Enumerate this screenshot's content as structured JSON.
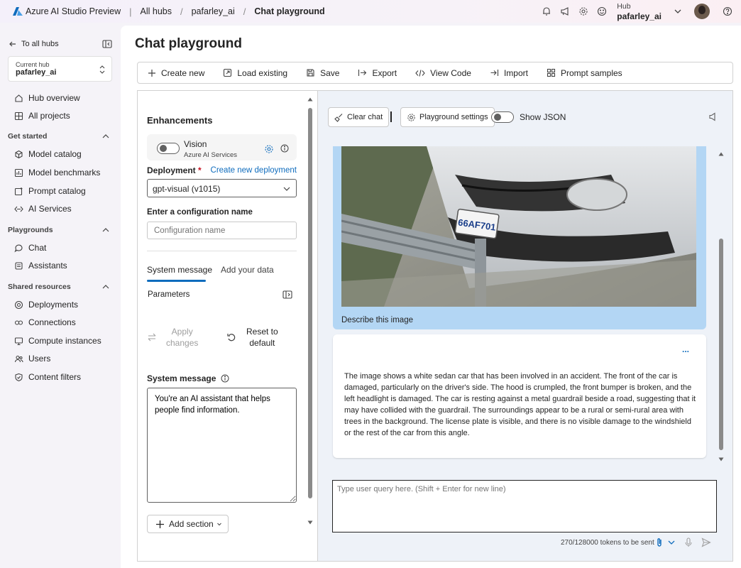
{
  "topbar": {
    "brand": "Azure AI Studio Preview",
    "breadcrumbs": [
      "All hubs",
      "pafarley_ai",
      "Chat playground"
    ],
    "hub_label": "Hub",
    "hub_name": "pafarley_ai"
  },
  "sidebar": {
    "back_label": "To all hubs",
    "current_hub_label": "Current hub",
    "current_hub_name": "pafarley_ai",
    "items_top": [
      "Hub overview",
      "All projects"
    ],
    "section_get_started": "Get started",
    "items_get_started": [
      "Model catalog",
      "Model benchmarks",
      "Prompt catalog",
      "AI Services"
    ],
    "section_playgrounds": "Playgrounds",
    "items_playgrounds": [
      "Chat",
      "Assistants"
    ],
    "section_shared": "Shared resources",
    "items_shared": [
      "Deployments",
      "Connections",
      "Compute instances",
      "Users",
      "Content filters"
    ]
  },
  "page": {
    "title": "Chat playground",
    "toolbar": [
      "Create new",
      "Load existing",
      "Save",
      "Export",
      "View Code",
      "Import",
      "Prompt samples"
    ]
  },
  "setup": {
    "enhancements_title": "Enhancements",
    "vision_label": "Vision",
    "vision_sub": "Azure AI Services",
    "deployment_label": "Deployment",
    "deployment_required": "*",
    "create_deployment_link": "Create new deployment",
    "deployment_value": "gpt-visual (v1015)",
    "config_label": "Enter a configuration name",
    "config_placeholder": "Configuration name",
    "tab_system": "System message",
    "tab_data": "Add your data",
    "parameters_label": "Parameters",
    "apply_line1": "Apply",
    "apply_line2": "changes",
    "reset_line1": "Reset to",
    "reset_line2": "default",
    "system_message_label": "System message",
    "system_message_value": "You're an AI assistant that helps people find information.",
    "add_section": "Add section"
  },
  "chat": {
    "clear_chat": "Clear chat",
    "playground_settings": "Playground settings",
    "show_json": "Show JSON",
    "user_caption": "Describe this image",
    "image_plate": "66AF701",
    "more": "...",
    "assistant_reply": "The image shows a white sedan car that has been involved in an accident. The front of the car is damaged, particularly on the driver's side. The hood is crumpled, the front bumper is broken, and the left headlight is damaged. The car is resting against a metal guardrail beside a road, suggesting that it may have collided with the guardrail. The surroundings appear to be a rural or semi-rural area with trees in the background. The license plate is visible, and there is no visible damage to the windshield or the rest of the car from this angle.",
    "input_placeholder": "Type user query here. (Shift + Enter for new line)",
    "token_count": "270/128000 tokens to be sent"
  },
  "colors": {
    "accent": "#0f6cbd",
    "user_bubble": "#b3d6f4",
    "chat_bg": "#eef2f8"
  }
}
